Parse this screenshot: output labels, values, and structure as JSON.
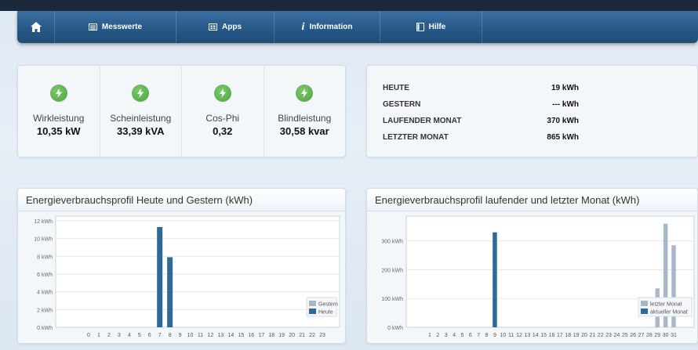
{
  "nav": {
    "items": [
      {
        "label": "Messwerte",
        "icon": "table-icon"
      },
      {
        "label": "Apps",
        "icon": "apps-icon"
      },
      {
        "label": "Information",
        "icon": "info-icon"
      },
      {
        "label": "Hilfe",
        "icon": "book-icon"
      }
    ]
  },
  "meters": [
    {
      "label": "Wirkleistung",
      "value": "10,35 kW"
    },
    {
      "label": "Scheinleistung",
      "value": "33,39 kVA"
    },
    {
      "label": "Cos-Phi",
      "value": "0,32"
    },
    {
      "label": "Blindleistung",
      "value": "30,58 kvar"
    }
  ],
  "energy": [
    {
      "label": "HEUTE",
      "value": "19 kWh"
    },
    {
      "label": "GESTERN",
      "value": "--- kWh"
    },
    {
      "label": "LAUFENDER MONAT",
      "value": "370 kWh"
    },
    {
      "label": "LETZTER MONAT",
      "value": "865 kWh"
    }
  ],
  "colors": {
    "nav": "#275988",
    "accent": "#2e6a96",
    "secondary": "#a8b8c8",
    "bolt": "#5aae4a"
  },
  "chart_data": [
    {
      "type": "bar",
      "title": "Energieverbrauchsprofil Heute und Gestern (kWh)",
      "categories": [
        "0",
        "1",
        "2",
        "3",
        "4",
        "5",
        "6",
        "7",
        "8",
        "9",
        "10",
        "11",
        "12",
        "13",
        "14",
        "15",
        "16",
        "17",
        "18",
        "19",
        "20",
        "21",
        "22",
        "23"
      ],
      "yticks": [
        "0 kWh",
        "2 kWh",
        "4 kWh",
        "6 kWh",
        "8 kWh",
        "10 kWh",
        "12 kWh"
      ],
      "ylim": [
        0,
        12
      ],
      "series": [
        {
          "name": "Gestern",
          "color": "#a8b8c8",
          "values": [
            0,
            0,
            0,
            0,
            0,
            0,
            0,
            0,
            0,
            0,
            0,
            0,
            0,
            0,
            0,
            0,
            0,
            0,
            0,
            0,
            0,
            0,
            0,
            0
          ]
        },
        {
          "name": "Heute",
          "color": "#2e6a96",
          "values": [
            0,
            0,
            0,
            0,
            0,
            0,
            0,
            11.3,
            7.9,
            0,
            0,
            0,
            0,
            0,
            0,
            0,
            0,
            0,
            0,
            0,
            0,
            0,
            0,
            0
          ]
        }
      ],
      "legend": "bottom-right"
    },
    {
      "type": "bar",
      "title": "Energieverbrauchsprofil laufender und letzter Monat (kWh)",
      "categories": [
        "1",
        "2",
        "3",
        "4",
        "5",
        "6",
        "7",
        "8",
        "9",
        "10",
        "11",
        "12",
        "13",
        "14",
        "15",
        "16",
        "17",
        "18",
        "19",
        "20",
        "21",
        "22",
        "23",
        "24",
        "25",
        "26",
        "27",
        "28",
        "29",
        "30",
        "31"
      ],
      "yticks": [
        "0 kWh",
        "100 kWh",
        "200 kWh",
        "300 kWh"
      ],
      "ylim": [
        0,
        370
      ],
      "series": [
        {
          "name": "letzter Monat",
          "color": "#a8b8c8",
          "values": [
            0,
            0,
            0,
            0,
            0,
            0,
            0,
            0,
            0,
            0,
            0,
            0,
            0,
            0,
            0,
            0,
            0,
            0,
            0,
            0,
            0,
            0,
            0,
            0,
            0,
            0,
            0,
            0,
            135,
            360,
            285
          ]
        },
        {
          "name": "aktueller Monat",
          "color": "#2e6a96",
          "values": [
            0,
            0,
            0,
            0,
            0,
            0,
            0,
            0,
            330,
            0,
            0,
            0,
            0,
            0,
            0,
            0,
            0,
            0,
            0,
            0,
            0,
            0,
            0,
            0,
            0,
            0,
            0,
            0,
            0,
            0,
            0
          ]
        }
      ],
      "legend": "bottom-right"
    }
  ]
}
